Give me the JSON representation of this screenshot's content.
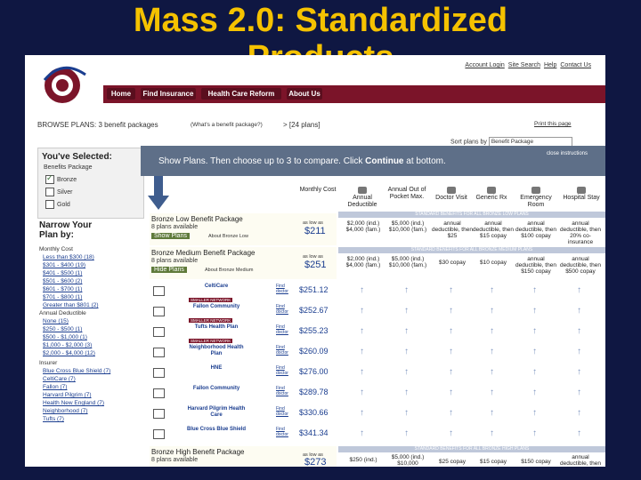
{
  "slide": {
    "title_line1": "Mass 2.0: Standardized",
    "title_line2": "Products"
  },
  "header": {
    "logo_text": "HealthConnector",
    "top_links": [
      "Account Login",
      "Site Search",
      "Help",
      "Contact Us"
    ],
    "nav": [
      "Home",
      "Find Insurance",
      "Health Care Reform",
      "About Us"
    ]
  },
  "browse": {
    "label": "BROWSE PLANS:  3 benefit packages",
    "what_link": "(What's a benefit package?)",
    "count": "> [24 plans]",
    "print": "Print this page",
    "sort_label": "Sort plans by",
    "sort_value": "Benefit Package"
  },
  "selected": {
    "title": "You've Selected:",
    "subtitle": "Benefits Package",
    "items": [
      {
        "label": "Bronze",
        "checked": true
      },
      {
        "label": "Silver",
        "checked": false
      },
      {
        "label": "Gold",
        "checked": false
      }
    ]
  },
  "narrow": {
    "title_line1": "Narrow Your",
    "title_line2": "Plan by:"
  },
  "filters": {
    "monthly": {
      "heading": "Monthly Cost",
      "items": [
        "Less than $300 (18)",
        "$301 - $400 (19)",
        "$401 - $500 (1)",
        "$501 - $600 (2)",
        "$601 - $700 (1)",
        "$701 - $800 (1)",
        "Greater than $801 (2)"
      ]
    },
    "deductible": {
      "heading": "Annual Deductible",
      "items": [
        "None (15)",
        "$250 - $500 (1)",
        "$500 - $1,000 (1)",
        "$1,000 - $2,000 (3)",
        "$2,000 - $4,000 (12)"
      ]
    },
    "insurer": {
      "heading": "Insurer",
      "items": [
        "Blue Cross Blue Shield (7)",
        "CeltiCare (7)",
        "Fallon (7)",
        "Harvard Pilgrim (7)",
        "Health New England (7)",
        "Neighborhood (7)",
        "Tufts (7)"
      ]
    }
  },
  "instructions": {
    "text_pre": "Show Plans. Then choose up to 3 to compare. Click ",
    "text_bold": "Continue",
    "text_post": " at bottom.",
    "close": "close instructions"
  },
  "columns": [
    "Monthly Cost",
    "Annual Deductible",
    "Annual Out of Pocket Max.",
    "Doctor Visit",
    "Generic Rx",
    "Emergency Room",
    "Hospital Stay"
  ],
  "packages": [
    {
      "name": "Bronze Low Benefit Package",
      "sub": "8 plans available",
      "link": "Show Plans",
      "about": "About Bronze Low",
      "as_low_as": "as low as",
      "price": "$211",
      "std_label": "STANDARD BENEFITS FOR ALL BRONZE LOW PLANS",
      "cells": [
        "$2,000 (ind.) $4,000 (fam.)",
        "$5,000 (ind.) $10,000 (fam.)",
        "annual deductible, then $25",
        "annual deductible, then $15 copay",
        "annual deductible, then $100 copay",
        "annual deductible, then 20% co-insurance"
      ]
    },
    {
      "name": "Bronze Medium Benefit Package",
      "sub": "8 plans available",
      "link": "Hide Plans",
      "about": "About Bronze Medium",
      "as_low_as": "as low as",
      "price": "$251",
      "std_label": "STANDARD BENEFITS FOR ALL BRONZE MEDIUM PLANS",
      "cells": [
        "$2,000 (ind.) $4,000 (fam.)",
        "$5,000 (ind.) $10,000 (fam.)",
        "$30 copay",
        "$10 copay",
        "annual deductible, then $150 copay",
        "annual deductible, then $500 copay"
      ]
    },
    {
      "name": "Bronze High Benefit Package",
      "sub": "8 plans available",
      "as_low_as": "as low as",
      "price": "$273",
      "std_label": "STANDARD BENEFITS FOR ALL BRONZE HIGH PLANS",
      "cells": [
        "$250 (ind.)",
        "$5,000 (ind.) $10,000",
        "$25 copay",
        "$15 copay",
        "$150 copay",
        "annual deductible, then"
      ]
    }
  ],
  "plans": [
    {
      "insurer": "CeltiCare",
      "price": "$251.12"
    },
    {
      "insurer": "Fallon Community",
      "price": "$252.67"
    },
    {
      "insurer": "Tufts Health Plan",
      "price": "$255.23"
    },
    {
      "insurer": "Neighborhood Health Plan",
      "price": "$260.09"
    },
    {
      "insurer": "HNE",
      "price": "$276.00"
    },
    {
      "insurer": "Fallon Community",
      "price": "$289.78"
    },
    {
      "insurer": "Harvard Pilgrim Health Care",
      "price": "$330.66"
    },
    {
      "insurer": "Blue Cross Blue Shield",
      "price": "$341.34"
    }
  ],
  "tags": {
    "smaller_network": "SMALLER NETWORK"
  },
  "find_doctor": "Find doctor",
  "colors": {
    "title": "#f5c200",
    "background": "#0f1742",
    "nav": "#7b1429",
    "accent_link": "#1a3d8f"
  }
}
